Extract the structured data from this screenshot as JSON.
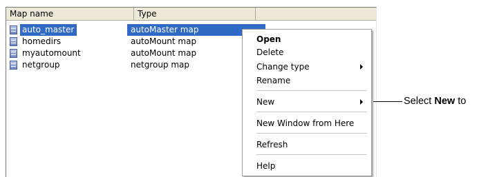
{
  "list": {
    "columns": [
      "Map name",
      "Type"
    ],
    "rows": [
      {
        "name": "auto_master",
        "type": "autoMaster map",
        "selected": true,
        "icon": "map-icon"
      },
      {
        "name": "homedirs",
        "type": "autoMount map",
        "selected": false,
        "icon": "map-icon"
      },
      {
        "name": "myautomount",
        "type": "autoMount map",
        "selected": false,
        "icon": "map-icon"
      },
      {
        "name": "netgroup",
        "type": "netgroup map",
        "selected": false,
        "icon": "map-icon"
      }
    ]
  },
  "context_menu": {
    "items": {
      "open": "Open",
      "delete": "Delete",
      "change_type": "Change type",
      "rename": "Rename",
      "new": "New",
      "new_window": "New Window from Here",
      "refresh": "Refresh",
      "help": "Help"
    }
  },
  "callout": {
    "prefix": "Select ",
    "bold": "New",
    "suffix": " to"
  },
  "colors": {
    "selection": "#316ac5",
    "header_bg": "#ece9d8"
  }
}
